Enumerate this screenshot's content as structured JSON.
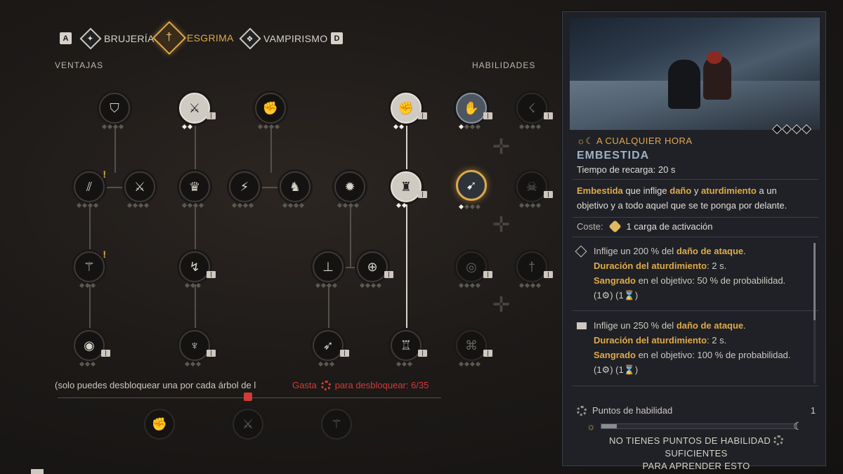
{
  "tabs": {
    "prev_key": "A",
    "next_key": "D",
    "items": [
      {
        "label": "BRUJERÍA",
        "icon": "witchcraft-icon"
      },
      {
        "label": "ESGRIMA",
        "icon": "sword-icon",
        "active": true
      },
      {
        "label": "VAMPIRISMO",
        "icon": "vampirism-icon"
      }
    ]
  },
  "sections": {
    "perks": "VENTAJAS",
    "skills": "HABILIDADES"
  },
  "bottom": {
    "note": "(solo puedes desbloquear una por cada árbol de l",
    "spend_prefix": "Gasta",
    "spend_suffix": "para desbloquear: 6/35"
  },
  "panel": {
    "time": "A CUALQUIER HORA",
    "title": "EMBESTIDA",
    "cooldown": "Tiempo de recarga: 20 s",
    "desc": {
      "w1": "Embestida",
      "t1": " que inflige ",
      "w2": "daño",
      "t2": " y ",
      "w3": "aturdimiento",
      "t3": " a un objetivo y a todo aquel que se te ponga por delante."
    },
    "cost_label": "Coste:",
    "cost_value": "1 carga de activación",
    "rank1": {
      "l1a": "Inflige un 200 % del ",
      "l1b": "daño de ataque",
      "l1c": ".",
      "l2a": "Duración del aturdimiento",
      "l2b": ": 2 s.",
      "l3a": "Sangrado",
      "l3b": " en el objetivo: 50 % de probabilidad.",
      "l4": "(1⚙) (1⌛)"
    },
    "rank2": {
      "l1a": "Inflige un 250 % del ",
      "l1b": "daño de ataque",
      "l1c": ".",
      "l2a": "Duración del aturdimiento",
      "l2b": ": 2 s.",
      "l3a": "Sangrado",
      "l3b": " en el objetivo: 100 % de probabilidad.",
      "l4": "(1⚙) (1⌛)"
    },
    "points_label": "Puntos de habilidad",
    "points_value": "1",
    "day_progress": 0.08,
    "no_points_a": "NO TIENES PUNTOS DE HABILIDAD",
    "no_points_b": "SUFICIENTES",
    "no_points_c": "PARA APRENDER ESTO"
  },
  "colors": {
    "accent": "#e0a94a",
    "danger": "#d23b36",
    "title_blue": "#9fb1c5"
  }
}
